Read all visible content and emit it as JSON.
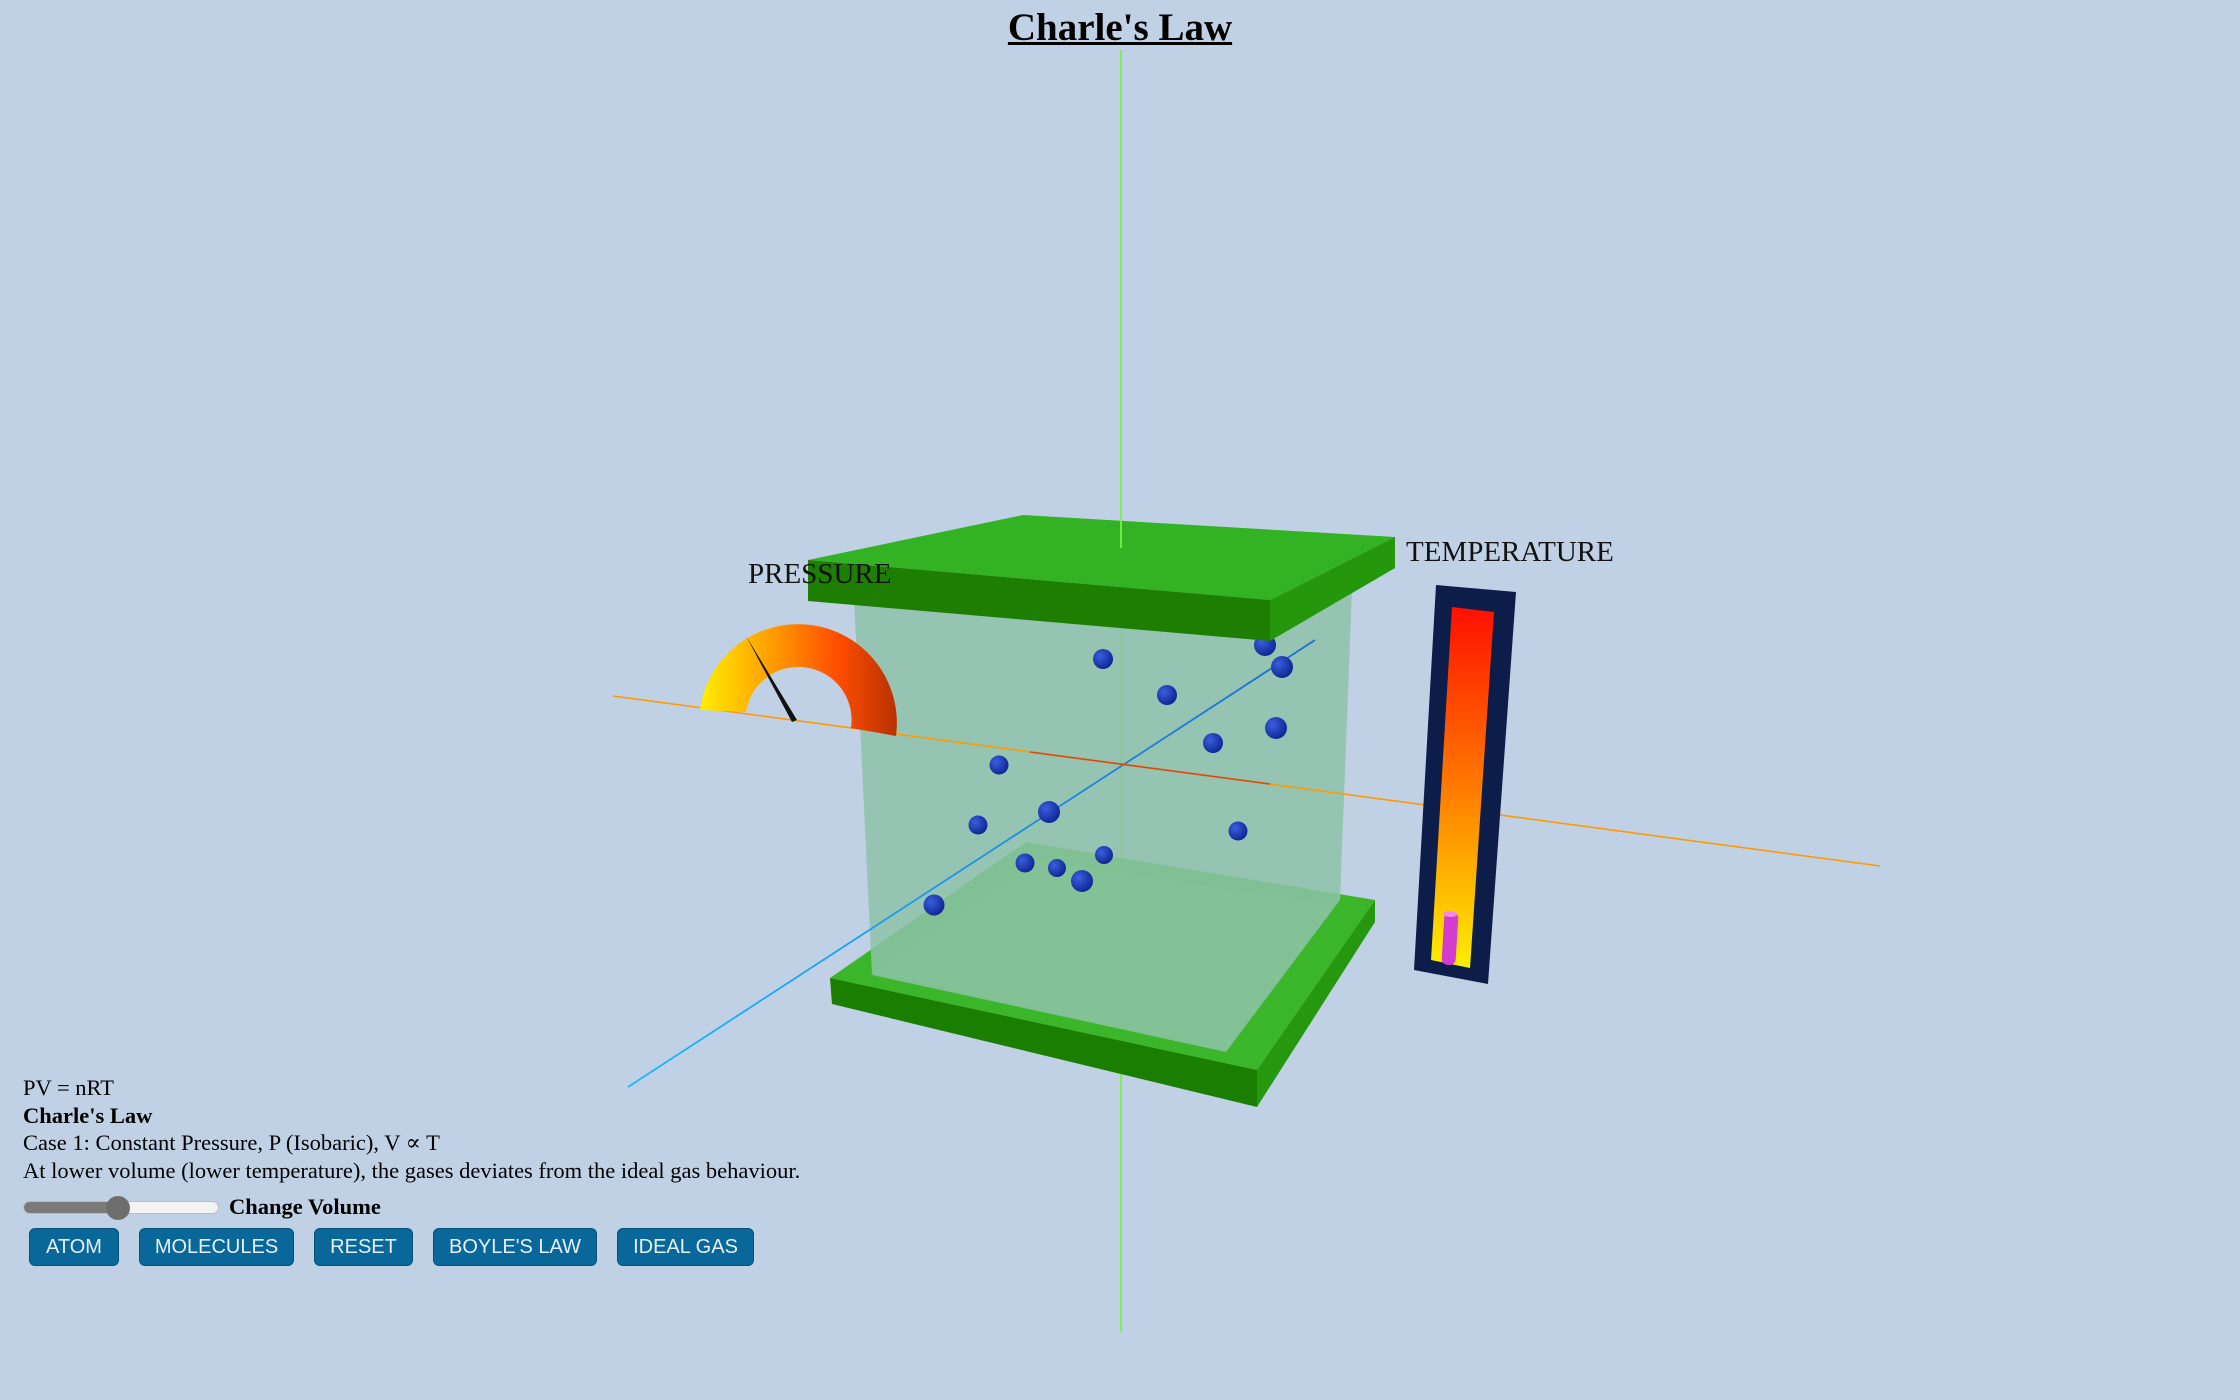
{
  "title": "Charle's Law",
  "gauge": {
    "label": "PRESSURE",
    "needle_level": 0.35
  },
  "thermometer": {
    "label": "TEMPERATURE",
    "fill_level": 0.1
  },
  "info": {
    "equation": "PV = nRT",
    "law_name": "Charle's Law",
    "case": "Case 1: Constant Pressure, P (Isobaric), V ∝ T",
    "note": "At lower volume (lower temperature), the gases deviates from the ideal gas behaviour."
  },
  "slider": {
    "label": "Change Volume",
    "value": 0.48
  },
  "buttons": {
    "atom": "ATOM",
    "molecules": "MOLECULES",
    "reset": "RESET",
    "boyles": "BOYLE'S LAW",
    "ideal": "IDEAL GAS"
  },
  "colors": {
    "background": "#c0d1e6",
    "piston": "#2aa61a",
    "gas": "#8ec2a8",
    "molecule": "#1a37a8",
    "button": "#0a6799",
    "x_axis": "#ff8c00",
    "y_axis": "#66ff33",
    "z_axis": "#00aaff"
  },
  "icons": {
    "molecule": "sphere-icon"
  }
}
